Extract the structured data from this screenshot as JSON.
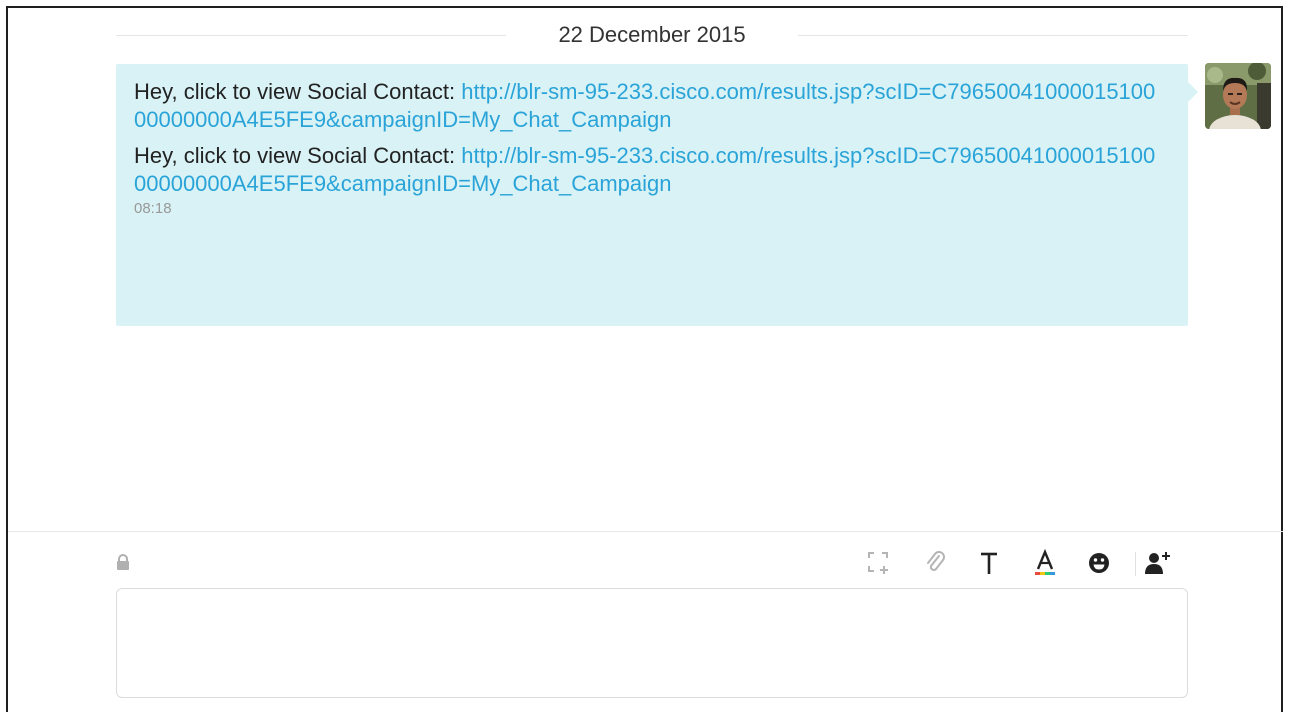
{
  "chat": {
    "date_separator": "22 December 2015",
    "messages": [
      {
        "text": "Hey, click to view Social Contact: ",
        "link": "http://blr-sm-95-233.cisco.com/results.jsp?scID=C7965004100001510000000000A4E5FE9&campaignID=My_Chat_Campaign"
      },
      {
        "text": "Hey, click to view Social Contact: ",
        "link": "http://blr-sm-95-233.cisco.com/results.jsp?scID=C7965004100001510000000000A4E5FE9&campaignID=My_Chat_Campaign"
      }
    ],
    "timestamp": "08:18"
  },
  "composer": {
    "placeholder": "",
    "value": ""
  },
  "toolbar": {
    "icons": [
      "screenshot-icon",
      "attachment-icon",
      "text-format-icon",
      "font-color-icon",
      "emoji-icon",
      "add-participant-icon"
    ]
  },
  "colors": {
    "bubble_bg": "#d9f2f6",
    "link": "#2aa4d8",
    "text": "#222222"
  }
}
